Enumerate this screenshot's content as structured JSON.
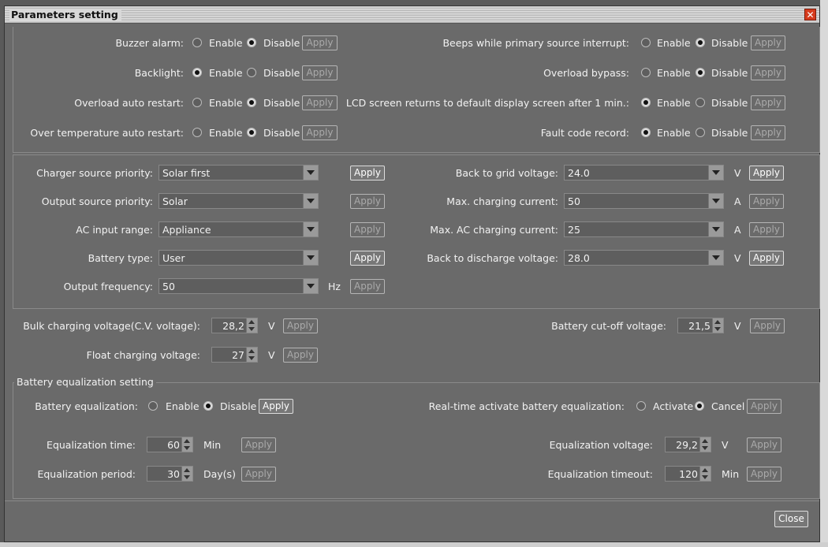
{
  "window": {
    "title": "Parameters setting",
    "close_label": "Close"
  },
  "options": {
    "enable": "Enable",
    "disable": "Disable",
    "activate": "Activate",
    "cancel": "Cancel",
    "apply": "Apply"
  },
  "section1": {
    "buzzer_alarm": "Buzzer alarm:",
    "backlight": "Backlight:",
    "overload_auto_restart": "Overload auto restart:",
    "over_temp_auto_restart": "Over temperature auto restart:",
    "beeps_interrupt": "Beeps while primary source interrupt:",
    "overload_bypass": "Overload bypass:",
    "lcd_return": "LCD screen returns to default display screen after 1 min.:",
    "fault_code_record": "Fault code record:"
  },
  "section2": {
    "charger_source_priority": {
      "label": "Charger source priority:",
      "value": "Solar first"
    },
    "output_source_priority": {
      "label": "Output source priority:",
      "value": "Solar"
    },
    "ac_input_range": {
      "label": "AC input range:",
      "value": "Appliance"
    },
    "battery_type": {
      "label": "Battery type:",
      "value": "User"
    },
    "output_frequency": {
      "label": "Output frequency:",
      "value": "50",
      "unit": "Hz"
    },
    "back_to_grid_voltage": {
      "label": "Back to grid voltage:",
      "value": "24.0",
      "unit": "V"
    },
    "max_charging_current": {
      "label": "Max. charging current:",
      "value": "50",
      "unit": "A"
    },
    "max_ac_charging_current": {
      "label": "Max. AC charging current:",
      "value": "25",
      "unit": "A"
    },
    "back_to_discharge_voltage": {
      "label": "Back to discharge voltage:",
      "value": "28.0",
      "unit": "V"
    }
  },
  "section3": {
    "bulk_voltage": {
      "label": "Bulk charging voltage(C.V. voltage):",
      "value": "28,2",
      "unit": "V"
    },
    "float_voltage": {
      "label": "Float charging voltage:",
      "value": "27",
      "unit": "V"
    },
    "cutoff_voltage": {
      "label": "Battery cut-off voltage:",
      "value": "21,5",
      "unit": "V"
    }
  },
  "section4": {
    "legend": "Battery equalization setting",
    "battery_equalization": "Battery equalization:",
    "realtime_activate": "Real-time activate battery equalization:",
    "eq_time": {
      "label": "Equalization time:",
      "value": "60",
      "unit": "Min"
    },
    "eq_period": {
      "label": "Equalization period:",
      "value": "30",
      "unit": "Day(s)"
    },
    "eq_voltage": {
      "label": "Equalization voltage:",
      "value": "29,2",
      "unit": "V"
    },
    "eq_timeout": {
      "label": "Equalization timeout:",
      "value": "120",
      "unit": "Min"
    }
  }
}
